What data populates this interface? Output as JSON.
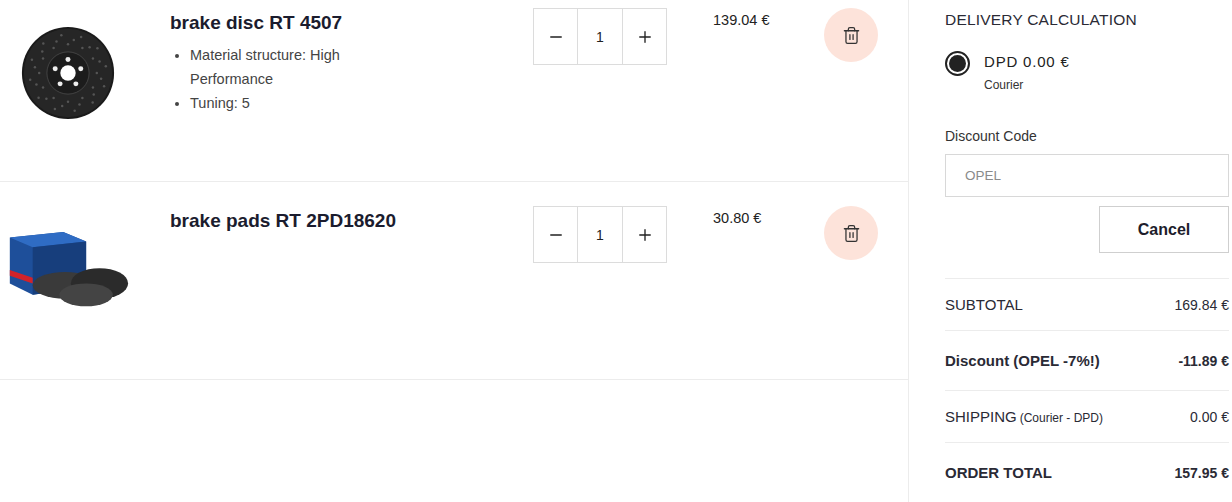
{
  "cart": {
    "items": [
      {
        "title": "brake disc RT 4507",
        "picture": "disc",
        "attributes": [
          "Material structure: High Performance",
          "Tuning: 5"
        ],
        "quantity": "1",
        "price": "139.04 €"
      },
      {
        "title": "brake pads RT 2PD18620",
        "picture": "pads",
        "attributes": [],
        "quantity": "1",
        "price": "30.80 €"
      }
    ]
  },
  "delivery": {
    "title": "DELIVERY CALCULATION",
    "options": [
      {
        "label": "DPD 0.00 €",
        "sublabel": "Courier",
        "selected": true
      }
    ]
  },
  "discount": {
    "label": "Discount Code",
    "placeholder": "OPEL",
    "button": "Cancel"
  },
  "summary": [
    {
      "label": "SUBTOTAL",
      "note": "",
      "value": "169.84 €",
      "bold": false
    },
    {
      "label": "Discount (OPEL -7%!)",
      "note": "",
      "value": "-11.89 €",
      "bold": true
    },
    {
      "label": "SHIPPING",
      "note": "(Courier - DPD)",
      "value": "0.00 €",
      "bold": false
    },
    {
      "label": "ORDER TOTAL",
      "note": "",
      "value": "157.95 €",
      "bold": true
    }
  ]
}
